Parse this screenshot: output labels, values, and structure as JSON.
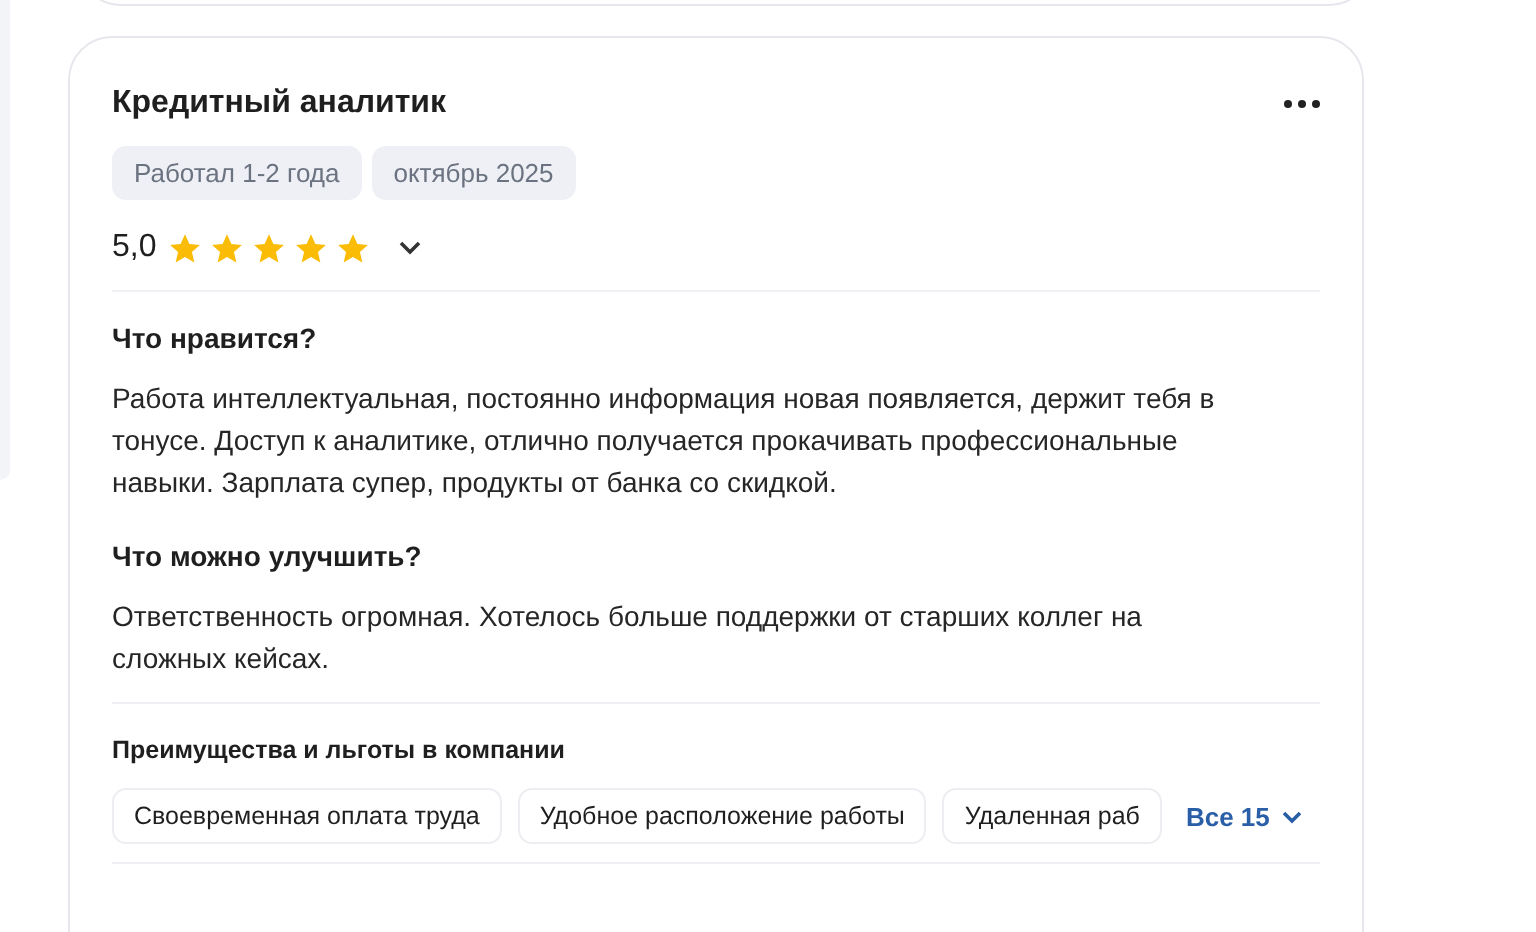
{
  "review": {
    "title": "Кредитный аналитик",
    "tags": [
      "Работал 1-2 года",
      "октябрь 2025"
    ],
    "rating": "5,0",
    "stars": 5,
    "sections": [
      {
        "heading": "Что нравится?",
        "text": "Работа интеллектуальная, постоянно информация новая появляется, держит тебя в тонусе. Доступ к аналитике, отлично получается прокачивать профессиональные навыки. Зарплата супер, продукты от банка со скидкой."
      },
      {
        "heading": "Что можно улучшить?",
        "text": "Ответственность огромная. Хотелось больше поддержки от старших коллег на сложных кейсах."
      }
    ],
    "benefits": {
      "heading": "Преимущества и льготы в компании",
      "items": [
        "Своевременная оплата труда",
        "Удобное расположение работы",
        "Удаленная раб"
      ],
      "more": "Все 15"
    }
  }
}
